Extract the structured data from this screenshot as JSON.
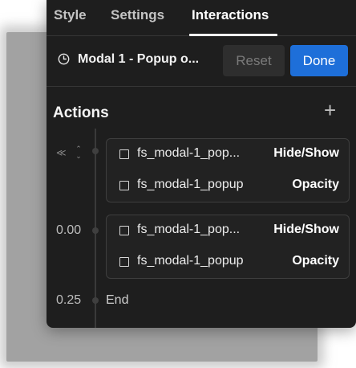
{
  "tabs": [
    {
      "label": "Style"
    },
    {
      "label": "Settings"
    },
    {
      "label": "Interactions"
    }
  ],
  "header": {
    "title": "Modal 1 - Popup o...",
    "reset_label": "Reset",
    "done_label": "Done"
  },
  "actions": {
    "title": "Actions",
    "add_icon": "plus-icon",
    "controls": {
      "collapse_glyph": "≪",
      "sort_glyph": "⌃⌄"
    },
    "groups": [
      {
        "time": "",
        "rows": [
          {
            "target": "fs_modal-1_pop...",
            "action": "Hide/Show"
          },
          {
            "target": "fs_modal-1_popup",
            "action": "Opacity"
          }
        ]
      },
      {
        "time": "0.00",
        "rows": [
          {
            "target": "fs_modal-1_pop...",
            "action": "Hide/Show"
          },
          {
            "target": "fs_modal-1_popup",
            "action": "Opacity"
          }
        ]
      }
    ],
    "end": {
      "time": "0.25",
      "label": "End"
    }
  },
  "colors": {
    "panel_bg": "#1e1e1e",
    "accent_blue": "#1e6fd9",
    "text": "#ebebeb",
    "muted": "#7a7a7a"
  }
}
